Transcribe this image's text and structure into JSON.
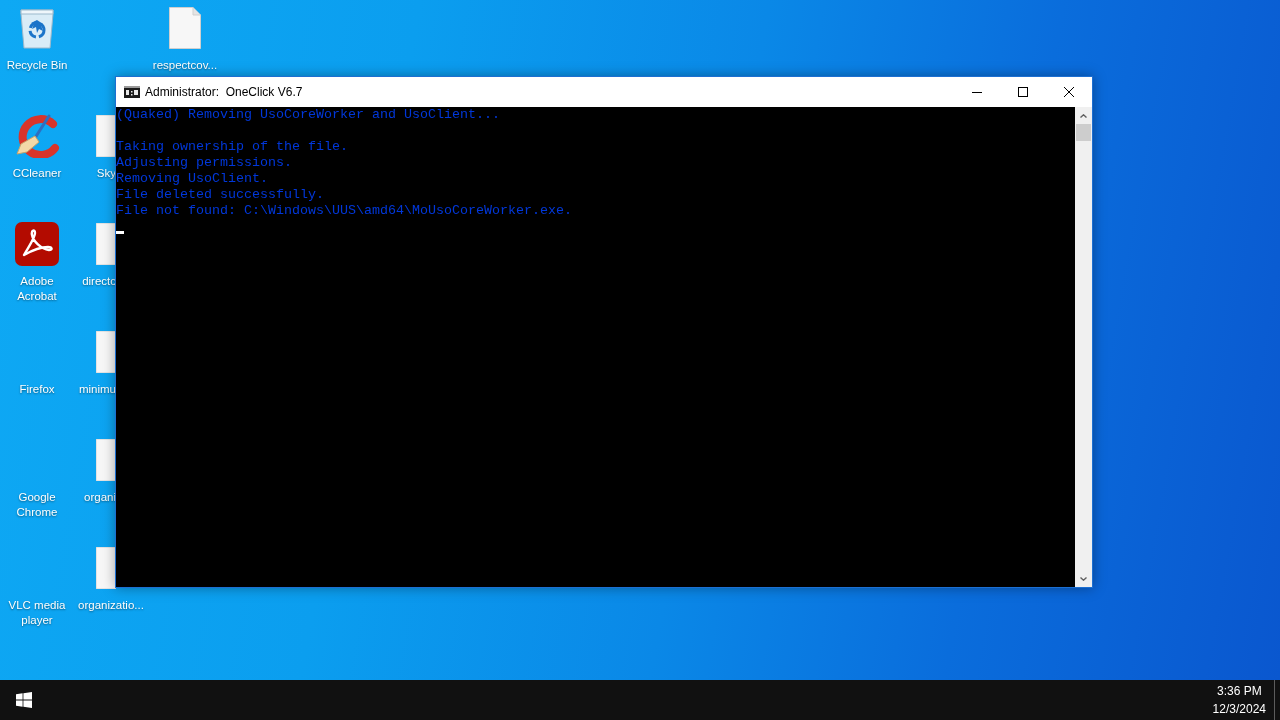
{
  "desktop": {
    "columns": [
      [
        {
          "label": "Recycle Bin",
          "kind": "recycle-bin"
        },
        {
          "label": "CCleaner",
          "kind": "broom"
        },
        {
          "label": "Adobe Acrobat",
          "kind": "app-tile"
        },
        {
          "label": "Firefox",
          "kind": "blank"
        },
        {
          "label": "Google Chrome",
          "kind": "blank"
        },
        {
          "label": "VLC media player",
          "kind": "blank"
        }
      ],
      [
        {
          "label": "Sky",
          "kind": "file"
        },
        {
          "label": "directc",
          "kind": "file"
        },
        {
          "label": "minimu",
          "kind": "file"
        },
        {
          "label": "organi",
          "kind": "file"
        },
        {
          "label": "organizatio...",
          "kind": "file"
        }
      ],
      [
        {
          "label": "respectcov...",
          "kind": "file"
        }
      ]
    ]
  },
  "window": {
    "title": "Administrator:  OneClick V6.7"
  },
  "console": {
    "blocks": [
      [
        "(Quaked) Removing UsoCoreWorker and UsoClient..."
      ],
      [
        "Taking ownership of the file.",
        "Adjusting permissions.",
        "Removing UsoClient.",
        "File deleted successfully.",
        "File not found: C:\\Windows\\UUS\\amd64\\MoUsoCoreWorker.exe."
      ]
    ]
  },
  "taskbar": {
    "time": "3:36 PM",
    "date": "12/3/2024"
  }
}
